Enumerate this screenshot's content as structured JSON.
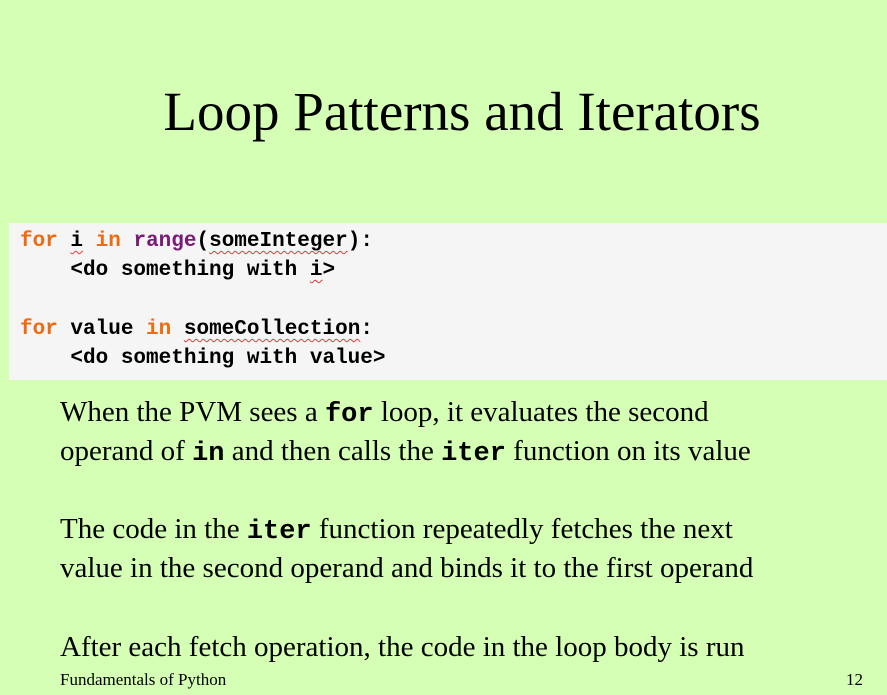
{
  "slide": {
    "title": "Loop Patterns and Iterators",
    "code": {
      "line1": {
        "kw_for": "for",
        "sp1": " ",
        "var": "i",
        "sp2": " ",
        "kw_in": "in",
        "sp3": " ",
        "fn": "range",
        "paren_open": "(",
        "arg": "someInteger",
        "paren_close": "):"
      },
      "line2": {
        "indent": "    ",
        "text_before": "<do something with ",
        "var": "i",
        "text_after": ">"
      },
      "line3": {
        "kw_for": "for",
        "sp1": " ",
        "var": "value",
        "sp2": " ",
        "kw_in": "in",
        "sp3": " ",
        "collection": "someCollection",
        "colon": ":"
      },
      "line4": {
        "indent": "    ",
        "text": "<do something with value>"
      }
    },
    "paragraphs": {
      "p1": {
        "line1_a": "When the PVM sees a ",
        "line1_code": "for",
        "line1_b": " loop, it evaluates the second",
        "line2_a": "operand of ",
        "line2_code": "in",
        "line2_b": " and then calls the ",
        "line2_code2": "iter",
        "line2_c": " function on its value"
      },
      "p2": {
        "line1_a": "The code in the ",
        "line1_code": "iter",
        "line1_b": " function repeatedly fetches the next",
        "line2": "value in the second operand and binds it to the first operand"
      },
      "p3": {
        "line1": "After each fetch operation, the code in the loop body is run"
      }
    },
    "footer": {
      "left": "Fundamentals of Python",
      "page_number": "12"
    }
  },
  "colors": {
    "background": "#d4ffb4",
    "code_background": "#f5f5f5",
    "keyword": "#ef6b11",
    "builtin_function": "#7a1a76",
    "spellcheck_underline": "#e23a3a"
  }
}
